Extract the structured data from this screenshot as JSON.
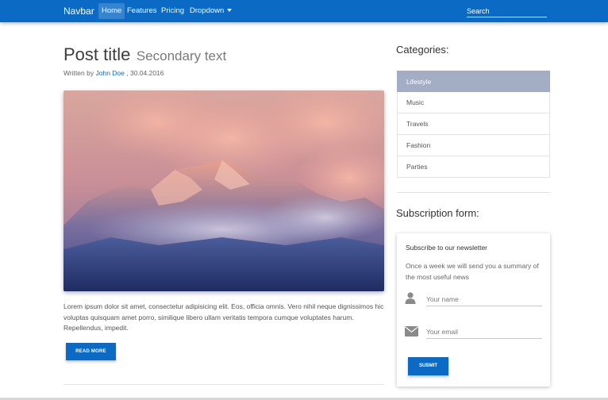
{
  "navbar": {
    "brand": "Navbar",
    "items": [
      {
        "label": "Home",
        "active": true
      },
      {
        "label": "Features",
        "active": false
      },
      {
        "label": "Pricing",
        "active": false
      },
      {
        "label": "Dropdown",
        "active": false
      }
    ],
    "search_placeholder": "Search",
    "color": "#0a6ac4"
  },
  "post": {
    "title": "Post title",
    "secondary": "Secondary text",
    "byline_prefix": "Written by",
    "author": "John Doe",
    "date_text": ", 30.04.2016",
    "body": "Lorem ipsum dolor sit amet, consectetur adipisicing elit. Eos, officia omnis. Vero nihil neque dignissimos hic voluptas quisquam amet porro, similique libero ullam veritatis tempora cumque voluptates harum. Repellendus, impedit.",
    "read_more": "READ MORE"
  },
  "sidebar": {
    "categories_heading": "Categories:",
    "categories": [
      {
        "label": "Lifestyle",
        "active": true
      },
      {
        "label": "Music",
        "active": false
      },
      {
        "label": "Travels",
        "active": false
      },
      {
        "label": "Fashion",
        "active": false
      },
      {
        "label": "Parties",
        "active": false
      }
    ],
    "subscription_heading": "Subscription form:",
    "form": {
      "title": "Subscribe to our newsletter",
      "text": "Once a week we will send you a summary of the most useful news",
      "name_placeholder": "Your name",
      "email_placeholder": "Your email",
      "submit": "SUBMIT"
    }
  }
}
